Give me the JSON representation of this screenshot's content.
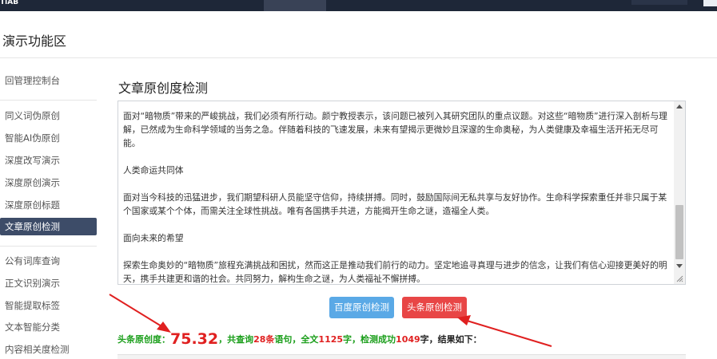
{
  "header": {
    "logo_text": "TiAB"
  },
  "area": {
    "title": "演示功能区"
  },
  "sidebar": {
    "items": [
      {
        "label": "回管理控制台"
      },
      {
        "label": "同义词伪原创"
      },
      {
        "label": "智能AI伪原创"
      },
      {
        "label": "深度改写演示"
      },
      {
        "label": "深度原创演示"
      },
      {
        "label": "深度原创标题"
      },
      {
        "label": "文章原创检测",
        "active": true
      },
      {
        "label": "公有词库查询"
      },
      {
        "label": "正文识别演示"
      },
      {
        "label": "智能提取标签"
      },
      {
        "label": "文本智能分类"
      },
      {
        "label": "内容相关度检测"
      }
    ]
  },
  "main": {
    "title": "文章原创度检测",
    "paragraphs": [
      "面对“暗物质”带来的严峻挑战，我们必须有所行动。颜宁教授表示，该问题已被列入其研究团队的重点议题。对这些“暗物质”进行深入剖析与理解，已然成为生命科学领域的当务之急。伴随着科技的飞速发展，未来有望揭示更微妙且深邃的生命奥秘，为人类健康及幸福生活开拓无尽可能。",
      "人类命运共同体",
      "面对当今科技的迅猛进步，我们期望科研人员能坚守信仰，持续拼搏。同时，鼓励国际间无私共享与友好协作。生命科学探索重任并非只属于某个国家或某个个体，而需关注全球性挑战。唯有各国携手共进，方能揭开生命之谜，造福全人类。",
      "面向未来的希望",
      "探索生命奥妙的“暗物质”旅程充满挑战和困扰，然而这正是推动我们前行的动力。坚定地追寻真理与进步的信念，让我们有信心迎接更美好的明天，携手共建更和谐的社会。共同努力，解构生命之谜，为人类福祉不懈拼搏。"
    ],
    "buttons": {
      "baidu": "百度原创检测",
      "toutiao": "头条原创检测"
    },
    "result": {
      "label": "头条原创度：",
      "score": "75.32",
      "part1": "，共查询",
      "query_count": "28条",
      "part2": "语句，全文",
      "total_chars": "1125",
      "part3": "字，检测成功",
      "success_chars": "1049",
      "part4": "字，结果如下："
    }
  },
  "colors": {
    "topbar": "#1e2738",
    "sidebar_active": "#3d4c68",
    "baidu_button": "#5aa9e6",
    "toutiao_button": "#e84646",
    "result_green": "#1a9e1a",
    "accent_red": "#e02020"
  }
}
